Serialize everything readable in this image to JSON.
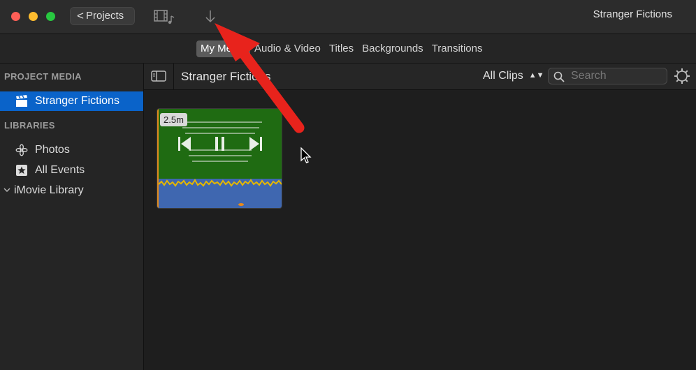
{
  "window": {
    "title": "Stranger Fictions",
    "back_label": "Projects",
    "back_chevron": "<"
  },
  "tabs": [
    {
      "label": "My Media",
      "active": true
    },
    {
      "label": "Audio & Video",
      "active": false
    },
    {
      "label": "Titles",
      "active": false
    },
    {
      "label": "Backgrounds",
      "active": false
    },
    {
      "label": "Transitions",
      "active": false
    }
  ],
  "sidebar": {
    "project_media_header": "PROJECT MEDIA",
    "project_item": "Stranger Fictions",
    "libraries_header": "LIBRARIES",
    "photos": "Photos",
    "all_events": "All Events",
    "library": "iMovie Library"
  },
  "browser": {
    "title": "Stranger Fictions",
    "clips_filter": "All Clips",
    "search_placeholder": "Search"
  },
  "clip": {
    "duration": "2.5m"
  },
  "colors": {
    "selection": "#0a63c9",
    "annotation_arrow": "#e8231c",
    "clip_video": "#1f6b12",
    "clip_audio": "#3f67b0"
  },
  "icons": [
    "media-browser-icon",
    "import-icon",
    "sidebar-toggle-icon",
    "search-icon",
    "gear-icon",
    "clapper-icon",
    "flower-icon",
    "star-icon"
  ]
}
